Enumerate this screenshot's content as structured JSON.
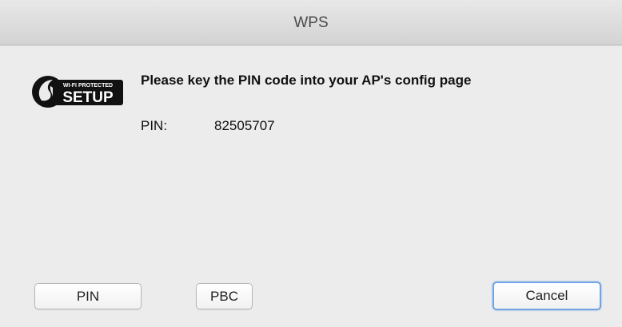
{
  "window": {
    "title": "WPS"
  },
  "logo": {
    "icon": "wifi-protected-setup-logo",
    "small_text": "WI-FI PROTECTED",
    "big_text": "SETUP"
  },
  "content": {
    "headline": "Please key the PIN code into your AP's config page",
    "pin_label": "PIN:",
    "pin_value": "82505707"
  },
  "buttons": {
    "pin_label": "PIN",
    "pbc_label": "PBC",
    "cancel_label": "Cancel"
  }
}
